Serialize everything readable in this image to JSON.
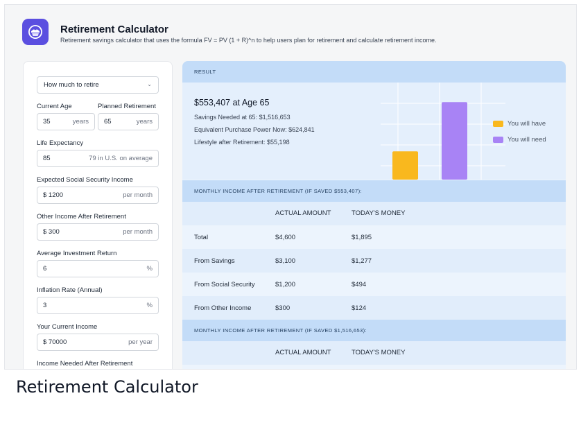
{
  "app": {
    "title": "Retirement Calculator",
    "description": "Retirement savings calculator that uses the formula FV = PV (1 + R)^n to help users plan for retirement and calculate retirement income.",
    "logo_icon": "piggy-bank-icon",
    "accent": "#5b4fe0"
  },
  "form": {
    "mode_select": "How much to retire",
    "current_age": {
      "label": "Current Age",
      "value": "35",
      "unit": "years"
    },
    "planned_retirement": {
      "label": "Planned Retirement",
      "value": "65",
      "unit": "years"
    },
    "life_expectancy": {
      "label": "Life Expectancy",
      "value": "85",
      "unit": "79 in U.S. on average"
    },
    "social_security": {
      "label": "Expected Social Security Income",
      "value": "$ 1200",
      "unit": "per month"
    },
    "other_income": {
      "label": "Other Income After Retirement",
      "value": "$ 300",
      "unit": "per month"
    },
    "investment_return": {
      "label": "Average Investment Return",
      "value": "6",
      "unit": "%"
    },
    "inflation": {
      "label": "Inflation Rate (Annual)",
      "value": "3",
      "unit": "%"
    },
    "current_income": {
      "label": "Your Current Income",
      "value": "$ 70000",
      "unit": "per year"
    },
    "income_needed": {
      "label": "Income Needed After Retirement"
    }
  },
  "result": {
    "header": "RESULT",
    "headline": "$553,407 at Age 65",
    "savings_needed": "Savings Needed at 65: $1,516,653",
    "purchase_power": "Equivalent Purchase Power Now: $624,841",
    "lifestyle": "Lifestyle after Retirement: $55,198",
    "legend": [
      {
        "label": "You will have",
        "color": "#f9b81e"
      },
      {
        "label": "You will need",
        "color": "#a883f5"
      }
    ]
  },
  "chart_data": {
    "type": "bar",
    "categories": [
      "You will have",
      "You will need"
    ],
    "values": [
      553407,
      1516653
    ],
    "colors": [
      "#f9b81e",
      "#a883f5"
    ],
    "ylim": [
      0,
      1900000
    ],
    "grid": true,
    "legend": "right"
  },
  "table1": {
    "title": "MONTHLY INCOME AFTER RETIREMENT (IF SAVED $553,407):",
    "headers": [
      "",
      "ACTUAL AMOUNT",
      "TODAY'S MONEY"
    ],
    "rows": [
      [
        "Total",
        "$4,600",
        "$1,895"
      ],
      [
        "From Savings",
        "$3,100",
        "$1,277"
      ],
      [
        "From Social Security",
        "$1,200",
        "$494"
      ],
      [
        "From Other Income",
        "$300",
        "$124"
      ]
    ]
  },
  "table2": {
    "title": "MONTHLY INCOME AFTER RETIREMENT (IF SAVED $1,516,653):",
    "headers": [
      "",
      "ACTUAL AMOUNT",
      "TODAY'S MONEY"
    ]
  },
  "caption": "Retirement Calculator"
}
